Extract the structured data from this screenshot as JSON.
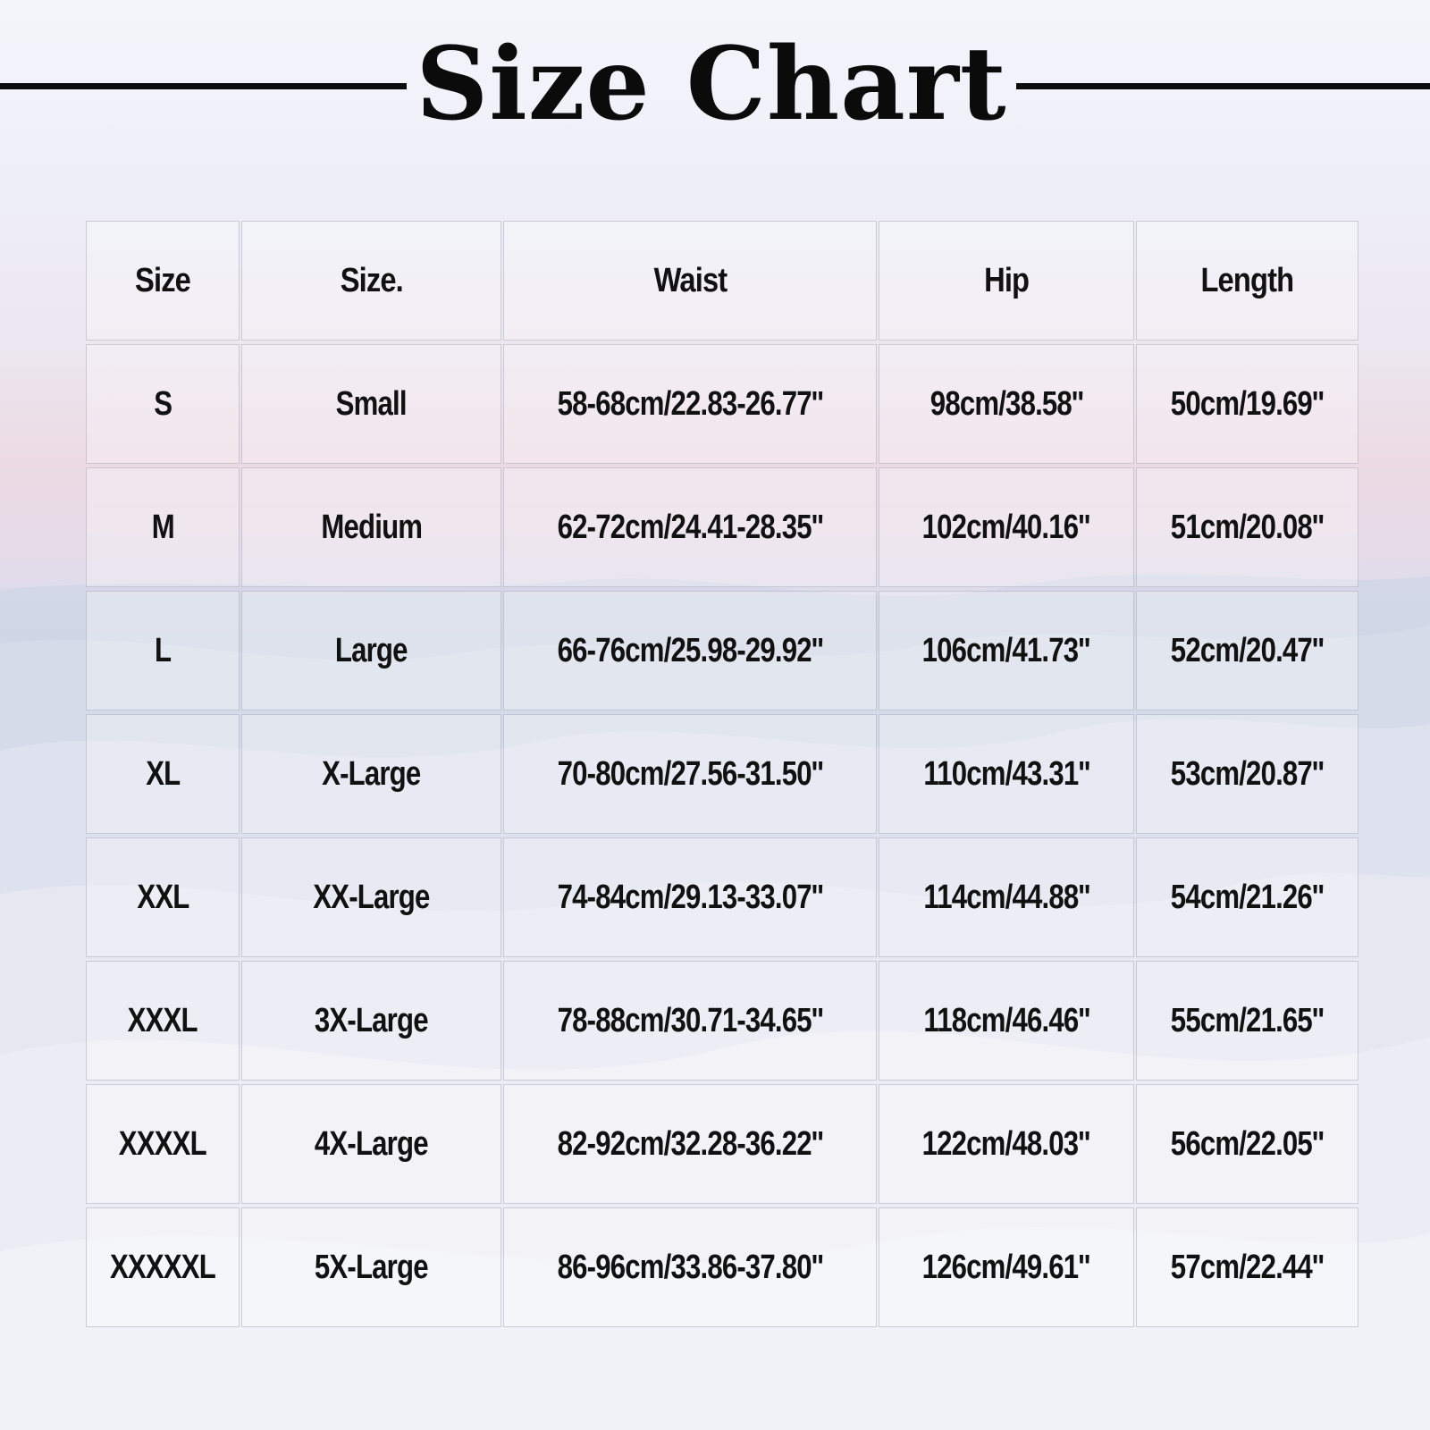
{
  "title": "Size Chart",
  "colors": {
    "title_text": "#0b0b0b",
    "rule": "#0c0c0c",
    "cell_text": "#111111"
  },
  "table": {
    "headers": [
      "Size",
      "Size.",
      "Waist",
      "Hip",
      "Length"
    ],
    "rows": [
      [
        "S",
        "Small",
        "58-68cm/22.83-26.77''",
        "98cm/38.58''",
        "50cm/19.69''"
      ],
      [
        "M",
        "Medium",
        "62-72cm/24.41-28.35''",
        "102cm/40.16''",
        "51cm/20.08''"
      ],
      [
        "L",
        "Large",
        "66-76cm/25.98-29.92''",
        "106cm/41.73''",
        "52cm/20.47''"
      ],
      [
        "XL",
        "X-Large",
        "70-80cm/27.56-31.50''",
        "110cm/43.31''",
        "53cm/20.87''"
      ],
      [
        "XXL",
        "XX-Large",
        "74-84cm/29.13-33.07''",
        "114cm/44.88''",
        "54cm/21.26''"
      ],
      [
        "XXXL",
        "3X-Large",
        "78-88cm/30.71-34.65''",
        "118cm/46.46''",
        "55cm/21.65''"
      ],
      [
        "XXXXL",
        "4X-Large",
        "82-92cm/32.28-36.22''",
        "122cm/48.03''",
        "56cm/22.05''"
      ],
      [
        "XXXXXL",
        "5X-Large",
        "86-96cm/33.86-37.80''",
        "126cm/49.61''",
        "57cm/22.44''"
      ]
    ]
  }
}
